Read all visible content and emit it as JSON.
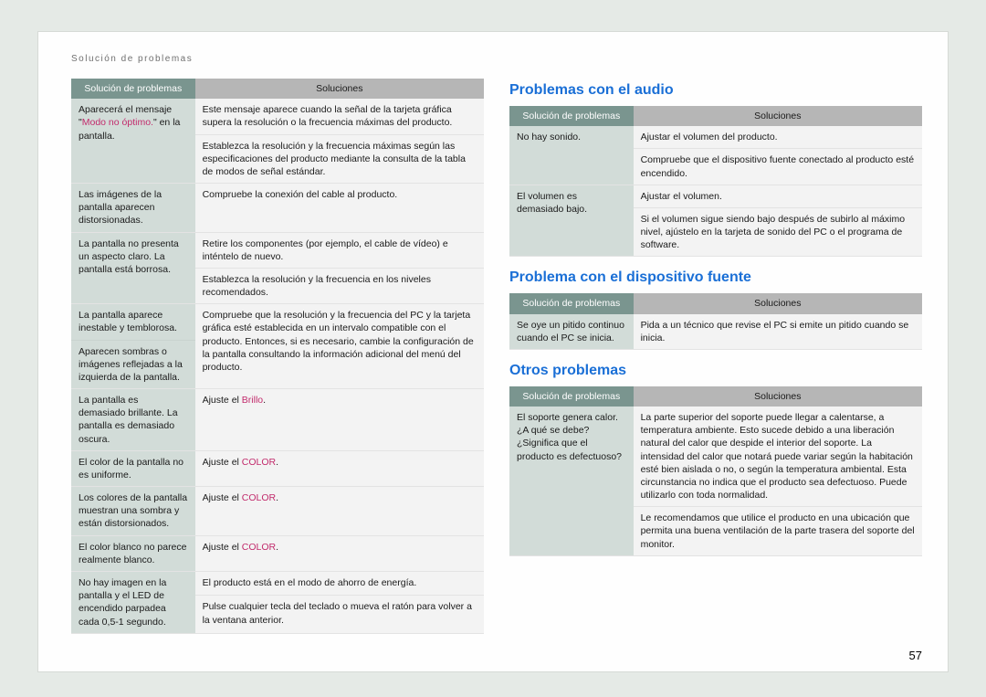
{
  "page_title": "Solución de problemas",
  "page_number": "57",
  "table_headers": {
    "problems": "Solución de problemas",
    "solutions": "Soluciones"
  },
  "pink": {
    "modo_no_optimo": "Modo no óptimo.",
    "brillo": "Brillo",
    "color1": "COLOR",
    "color2": "COLOR",
    "color3": "COLOR"
  },
  "left_table": [
    {
      "problem_pre": "Aparecerá el mensaje \"",
      "problem_post": "\" en la pantalla.",
      "pink_key": "modo_no_optimo",
      "solutions": [
        "Este mensaje aparece cuando la señal de la tarjeta gráfica supera la resolución o la frecuencia máximas del producto.",
        "Establezca la resolución y la frecuencia máximas según las especificaciones del producto mediante la consulta de la tabla de modos de señal estándar."
      ]
    },
    {
      "problem": "Las imágenes de la pantalla aparecen distorsionadas.",
      "solutions": [
        "Compruebe la conexión del cable al producto."
      ]
    },
    {
      "problem": "La pantalla no presenta un aspecto claro. La pantalla está borrosa.",
      "solutions": [
        "Retire los componentes (por ejemplo, el cable de vídeo) e inténtelo de nuevo.",
        "Establezca la resolución y la frecuencia en los niveles recomendados."
      ]
    },
    {
      "problem": "La pantalla aparece inestable y temblorosa.",
      "problem2": "Aparecen sombras o imágenes reflejadas a la izquierda de la pantalla.",
      "solutions": [
        "Compruebe que la resolución y la frecuencia del PC y la tarjeta gráfica esté establecida en un intervalo compatible con el producto. Entonces, si es necesario, cambie la configuración de la pantalla consultando la información adicional del menú del producto."
      ]
    },
    {
      "problem": "La pantalla es demasiado brillante. La pantalla es demasiado oscura.",
      "sol_pre": "Ajuste el ",
      "pink_key": "brillo",
      "sol_post": "."
    },
    {
      "problem": "El color de la pantalla no es uniforme.",
      "sol_pre": "Ajuste el ",
      "pink_key": "color1",
      "sol_post": "."
    },
    {
      "problem": "Los colores de la pantalla muestran una sombra y están distorsionados.",
      "sol_pre": "Ajuste el ",
      "pink_key": "color2",
      "sol_post": "."
    },
    {
      "problem": "El color blanco no parece realmente blanco.",
      "sol_pre": "Ajuste el ",
      "pink_key": "color3",
      "sol_post": "."
    },
    {
      "problem": "No hay imagen en la pantalla y el LED de encendido parpadea cada 0,5-1 segundo.",
      "solutions": [
        "El producto está en el modo de ahorro de energía.",
        "Pulse cualquier tecla del teclado o mueva el ratón para volver a la ventana anterior."
      ]
    }
  ],
  "sections": {
    "audio": "Problemas con el audio",
    "fuente": "Problema con el dispositivo fuente",
    "otros": "Otros problemas"
  },
  "audio_table": [
    {
      "problem": "No hay sonido.",
      "solutions": [
        "Ajustar el volumen del producto.",
        "Compruebe que el dispositivo fuente conectado al producto esté encendido."
      ]
    },
    {
      "problem": "El volumen es demasiado bajo.",
      "solutions": [
        "Ajustar el volumen.",
        "Si el volumen sigue siendo bajo después de subirlo al máximo nivel, ajústelo en la tarjeta de sonido del PC o el programa de software."
      ]
    }
  ],
  "fuente_table": [
    {
      "problem": "Se oye un pitido continuo cuando el PC se inicia.",
      "solutions": [
        "Pida a un técnico que revise el PC si emite un pitido cuando se inicia."
      ]
    }
  ],
  "otros_table": [
    {
      "problem": "El soporte genera calor. ¿A qué se debe? ¿Significa que el producto es defectuoso?",
      "solutions": [
        "La parte superior del soporte puede llegar a calentarse, a temperatura ambiente. Esto sucede debido a una liberación natural del calor que despide el interior del soporte. La intensidad del calor que notará puede variar según la habitación esté bien aislada o no, o según la temperatura ambiental. Esta circunstancia no indica que el producto sea defectuoso. Puede utilizarlo con toda normalidad.",
        "Le recomendamos que utilice el producto en una ubicación que permita una buena ventilación de la parte trasera del soporte del monitor."
      ]
    }
  ]
}
